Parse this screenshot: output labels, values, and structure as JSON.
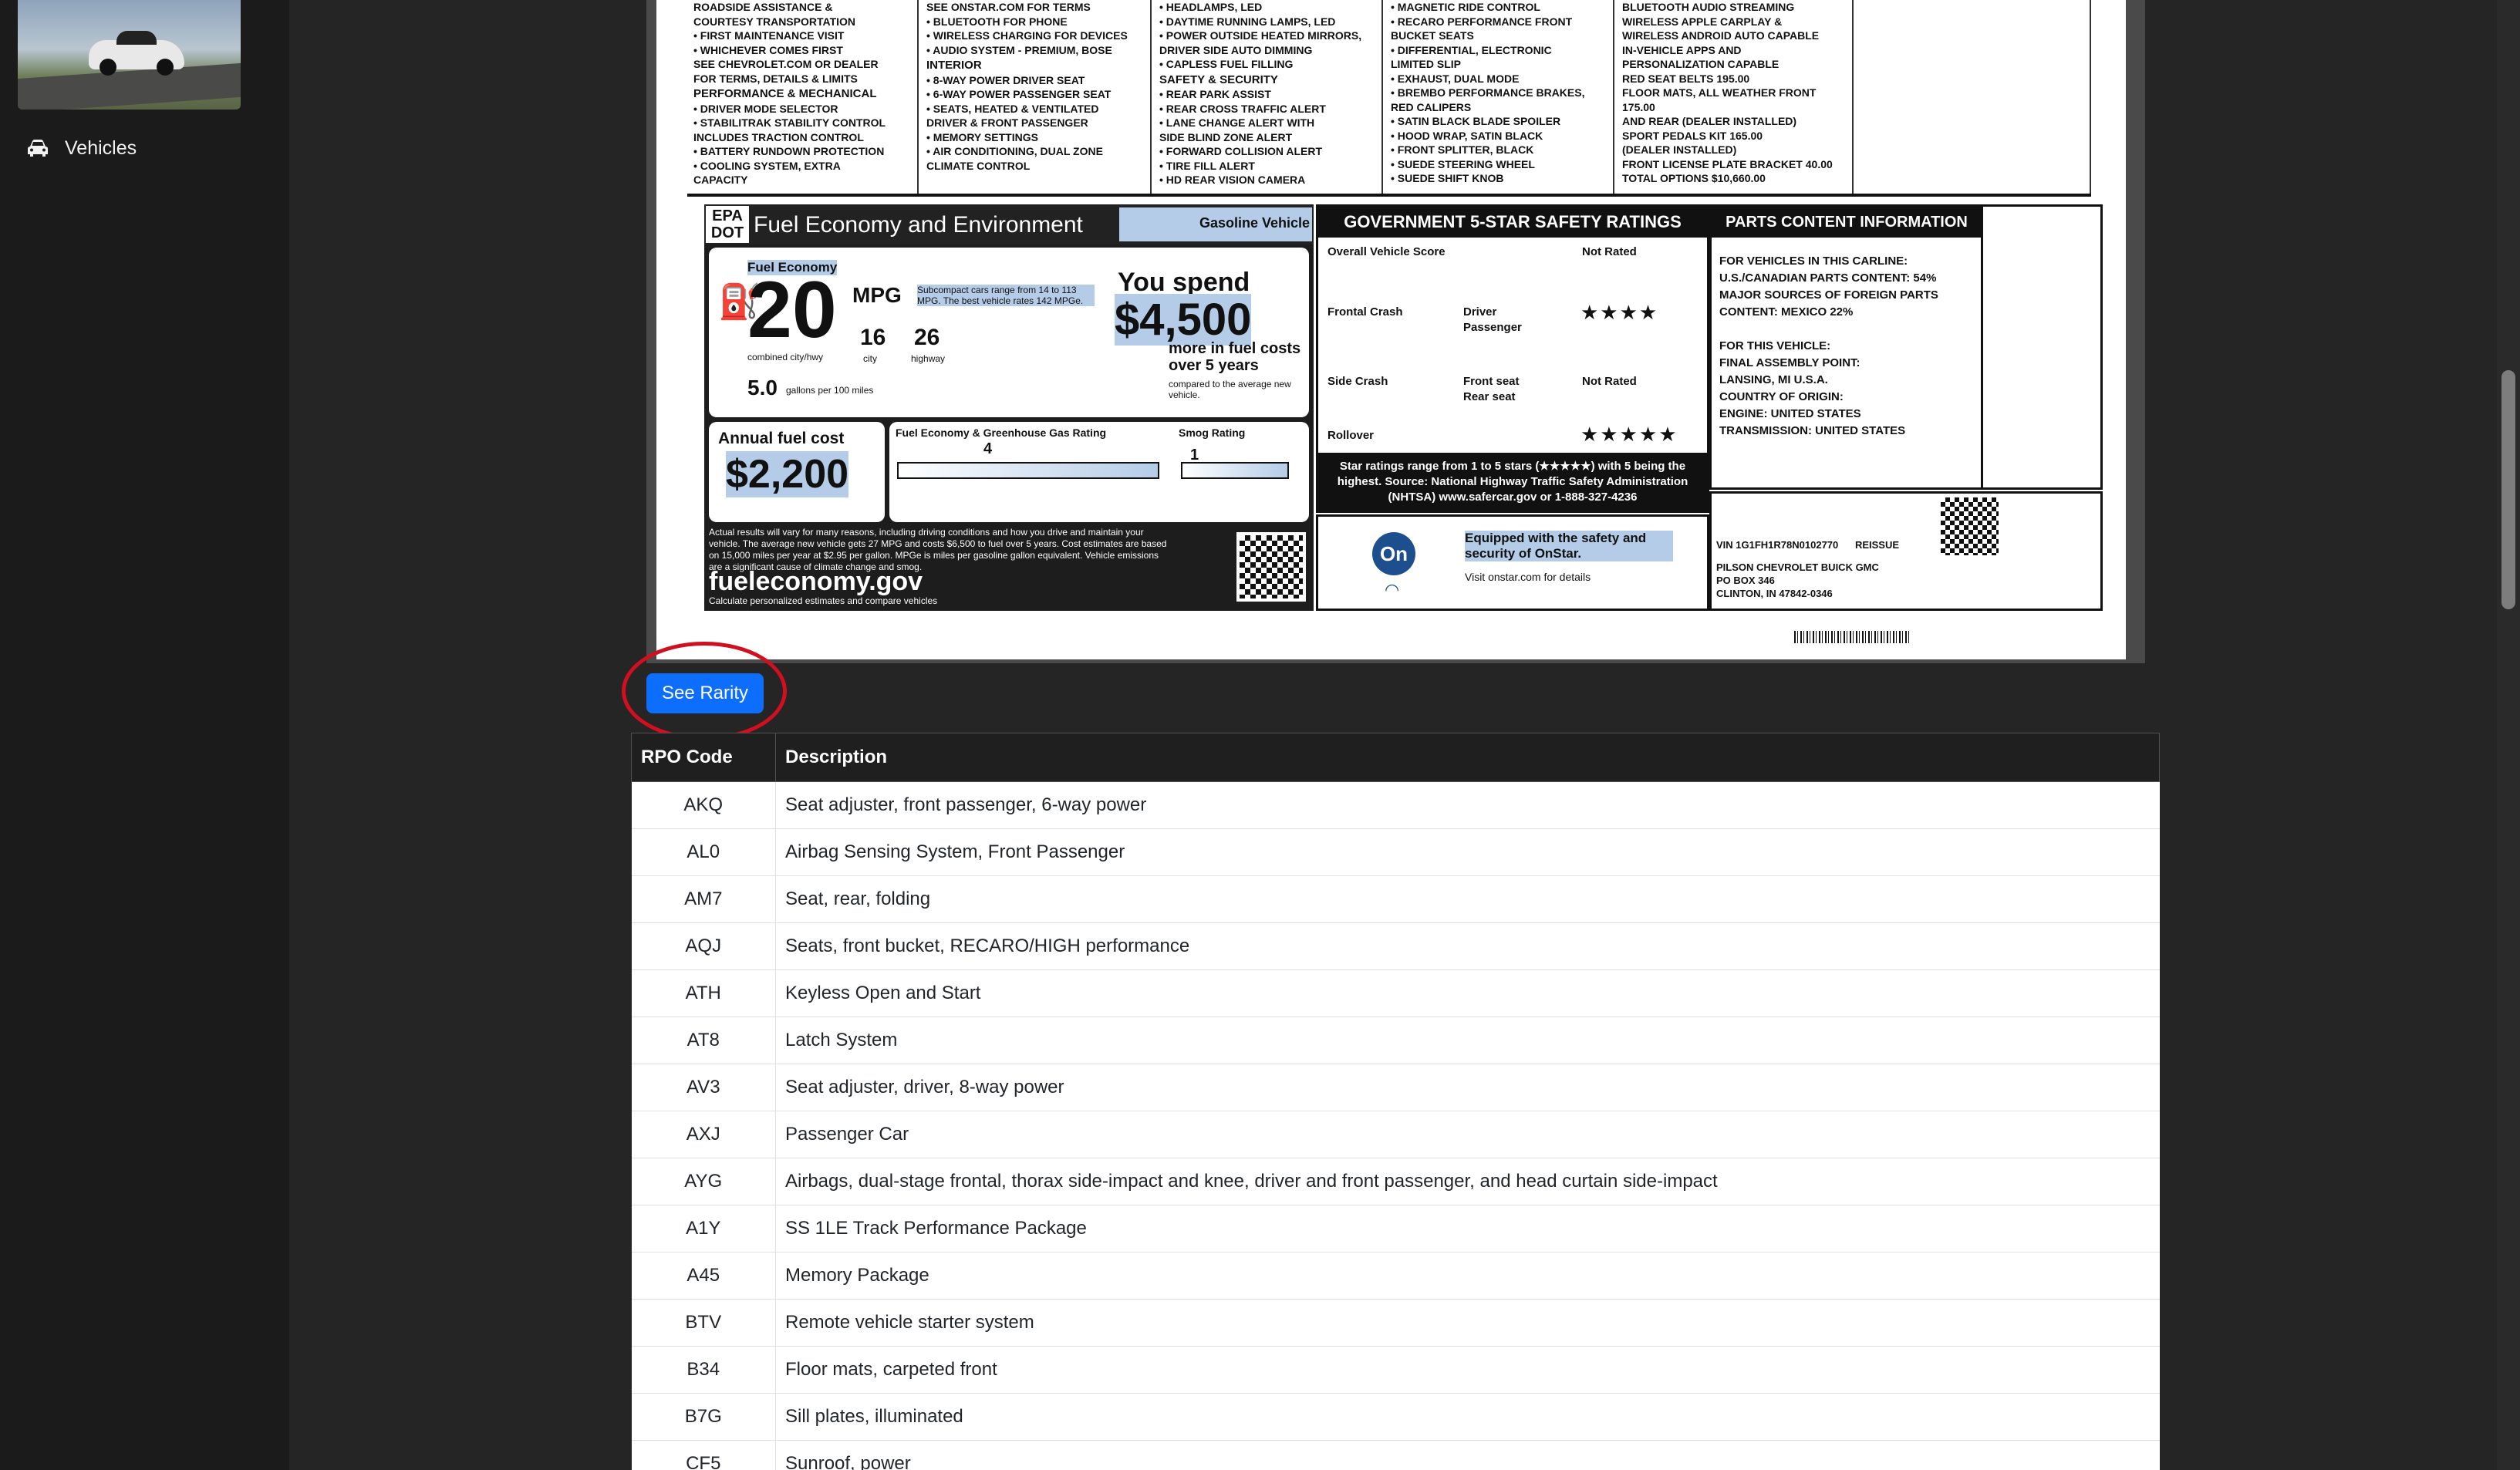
{
  "sidebar": {
    "thumbnail_alt": "Chevrolet Camaro ZL1 photo",
    "nav": [
      {
        "label": "Vehicles",
        "icon": "car-icon"
      }
    ]
  },
  "sticker": {
    "options_columns": [
      [
        "ROADSIDE ASSISTANCE &",
        "COURTESY TRANSPORTATION",
        "• FIRST MAINTENANCE VISIT",
        "• WHICHEVER COMES FIRST",
        "SEE CHEVROLET.COM OR DEALER",
        "FOR TERMS, DETAILS & LIMITS",
        "PERFORMANCE & MECHANICAL",
        "• DRIVER MODE SELECTOR",
        "• STABILITRAK STABILITY CONTROL",
        "INCLUDES TRACTION CONTROL",
        "• BATTERY RUNDOWN PROTECTION",
        "• COOLING SYSTEM, EXTRA",
        "CAPACITY"
      ],
      [
        "SEE ONSTAR.COM FOR TERMS",
        "• BLUETOOTH FOR PHONE",
        "• WIRELESS CHARGING FOR DEVICES",
        "• AUDIO SYSTEM - PREMIUM, BOSE",
        "INTERIOR",
        "• 8-WAY POWER DRIVER SEAT",
        "• 6-WAY POWER PASSENGER SEAT",
        "• SEATS, HEATED & VENTILATED",
        "DRIVER & FRONT PASSENGER",
        "• MEMORY SETTINGS",
        "• AIR CONDITIONING, DUAL ZONE",
        "CLIMATE CONTROL"
      ],
      [
        "• HEADLAMPS, LED",
        "• DAYTIME RUNNING LAMPS, LED",
        "• POWER OUTSIDE HEATED MIRRORS,",
        "DRIVER SIDE AUTO DIMMING",
        "• CAPLESS FUEL FILLING",
        "SAFETY & SECURITY",
        "• REAR PARK ASSIST",
        "• REAR CROSS TRAFFIC ALERT",
        "• LANE CHANGE ALERT WITH",
        "SIDE BLIND ZONE ALERT",
        "• FORWARD COLLISION ALERT",
        "• TIRE FILL ALERT",
        "• HD REAR VISION CAMERA"
      ],
      [
        "• MAGNETIC RIDE CONTROL",
        "• RECARO PERFORMANCE FRONT",
        "BUCKET SEATS",
        "• DIFFERENTIAL, ELECTRONIC",
        "LIMITED SLIP",
        "• EXHAUST, DUAL MODE",
        "• BREMBO PERFORMANCE BRAKES,",
        "RED CALIPERS",
        "• SATIN BLACK BLADE SPOILER",
        "• HOOD WRAP, SATIN BLACK",
        "• FRONT SPLITTER, BLACK",
        "• SUEDE STEERING WHEEL",
        "• SUEDE SHIFT KNOB"
      ],
      [
        "BLUETOOTH AUDIO STREAMING",
        "WIRELESS APPLE CARPLAY &",
        "WIRELESS ANDROID AUTO CAPABLE",
        "IN-VEHICLE APPS AND",
        "PERSONALIZATION CAPABLE",
        "RED SEAT BELTS   195.00",
        "FLOOR MATS, ALL WEATHER FRONT   175.00",
        "AND REAR (DEALER INSTALLED)",
        "SPORT PEDALS KIT   165.00",
        "(DEALER INSTALLED)",
        "FRONT LICENSE PLATE BRACKET   40.00",
        "",
        "TOTAL OPTIONS   $10,660.00"
      ]
    ],
    "epa": {
      "badge": "EPA DOT",
      "title": "Fuel Economy and Environment",
      "vehicle_type": "Gasoline Vehicle",
      "fuel_economy_label": "Fuel Economy",
      "combined_mpg": "20",
      "mpg_unit": "MPG",
      "combined_note": "combined city/hwy",
      "city_mpg": "16",
      "city_label": "city",
      "hwy_mpg": "26",
      "hwy_label": "highway",
      "range_note": "Subcompact cars range from 14 to 113 MPG. The best vehicle rates 142 MPGe.",
      "gallons": "5.0",
      "gallons_note": "gallons per 100 miles",
      "you_spend_label": "You spend",
      "spend_amount": "$4,500",
      "spend_note": "more in fuel costs over 5 years",
      "spend_compare": "compared to the average new vehicle.",
      "annual_label": "Annual fuel cost",
      "annual_amount": "$2,200",
      "ghg_label": "Fuel Economy & Greenhouse Gas Rating",
      "ghg_value": "4",
      "smog_label": "Smog Rating",
      "smog_value": "1",
      "fine_print": "Actual results will vary for many reasons, including driving conditions and how you drive and maintain your vehicle. The average new vehicle gets 27 MPG and costs $6,500 to fuel over 5 years. Cost estimates are based on 15,000 miles per year at $2.95 per gallon. MPGe is miles per gasoline gallon equivalent. Vehicle emissions are a significant cause of climate change and smog.",
      "site": "fueleconomy.gov",
      "site_note": "Calculate personalized estimates and compare vehicles"
    },
    "safety": {
      "title": "GOVERNMENT 5-STAR SAFETY RATINGS",
      "overall_label": "Overall Vehicle Score",
      "overall_value": "Not Rated",
      "frontal_label": "Frontal Crash",
      "frontal_driver": "Driver",
      "frontal_passenger": "Passenger",
      "frontal_stars": "★★★★",
      "side_label": "Side Crash",
      "side_front": "Front seat",
      "side_rear": "Rear seat",
      "side_value": "Not Rated",
      "rollover_label": "Rollover",
      "rollover_stars": "★★★★★",
      "footer": "Star ratings range from 1 to 5 stars (★★★★★) with 5 being the highest. Source: National Highway Traffic Safety Administration (NHTSA) www.safercar.gov or 1-888-327-4236"
    },
    "parts": {
      "title": "PARTS CONTENT INFORMATION",
      "lines": [
        "FOR VEHICLES IN THIS CARLINE:",
        "U.S./CANADIAN PARTS CONTENT: 54%",
        "MAJOR SOURCES OF FOREIGN PARTS",
        "CONTENT: MEXICO 22%",
        "",
        "FOR THIS VEHICLE:",
        "FINAL ASSEMBLY POINT:",
        "LANSING, MI   U.S.A.",
        "COUNTRY OF ORIGIN:",
        "ENGINE: UNITED STATES",
        "TRANSMISSION: UNITED STATES"
      ]
    },
    "onstar": {
      "logo": "On",
      "text": "Equipped with the safety and security of OnStar.",
      "visit": "Visit onstar.com for details"
    },
    "dealer": {
      "vin": "VIN 1G1FH1R78N0102770",
      "reissue": "REISSUE",
      "name": "PILSON CHEVROLET BUICK GMC",
      "po": "PO BOX 346",
      "city": "CLINTON, IN 47842-0346"
    }
  },
  "rarity_button": "See Rarity",
  "table": {
    "headers": [
      "RPO Code",
      "Description"
    ],
    "rows": [
      [
        "AKQ",
        "Seat adjuster, front passenger, 6-way power"
      ],
      [
        "AL0",
        "Airbag Sensing System, Front Passenger"
      ],
      [
        "AM7",
        "Seat, rear, folding"
      ],
      [
        "AQJ",
        "Seats, front bucket, RECARO/HIGH performance"
      ],
      [
        "ATH",
        "Keyless Open and Start"
      ],
      [
        "AT8",
        "Latch System"
      ],
      [
        "AV3",
        "Seat adjuster, driver, 8-way power"
      ],
      [
        "AXJ",
        "Passenger Car"
      ],
      [
        "AYG",
        "Airbags, dual-stage frontal, thorax side-impact and knee, driver and front passenger, and head curtain side-impact"
      ],
      [
        "A1Y",
        "SS 1LE Track Performance Package"
      ],
      [
        "A45",
        "Memory Package"
      ],
      [
        "BTV",
        "Remote vehicle starter system"
      ],
      [
        "B34",
        "Floor mats, carpeted front"
      ],
      [
        "B7G",
        "Sill plates, illuminated"
      ],
      [
        "CF5",
        "Sunroof, power"
      ]
    ]
  },
  "colors": {
    "accent": "#0d6efd",
    "highlight_circle": "#d10f1f"
  }
}
